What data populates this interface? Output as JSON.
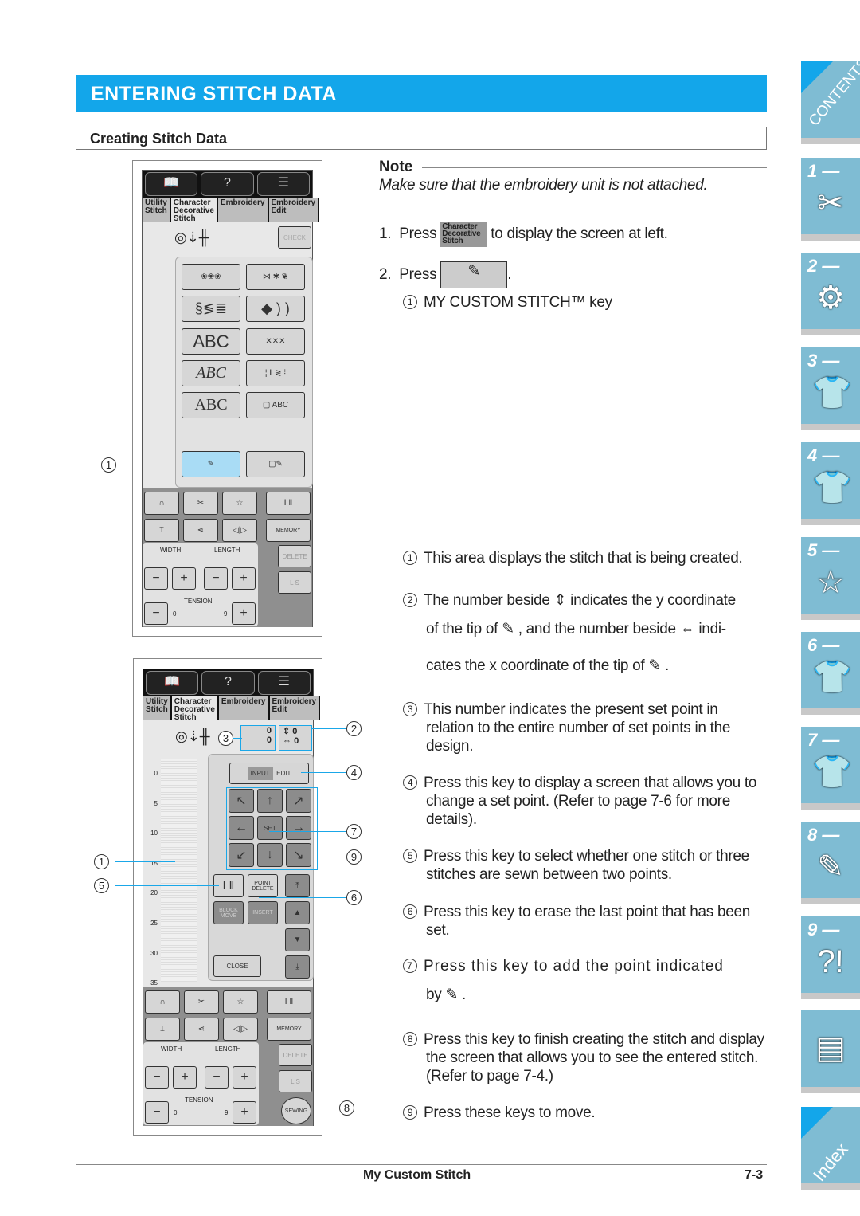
{
  "header": {
    "title": "ENTERING STITCH DATA",
    "subtitle": "Creating Stitch Data"
  },
  "screen": {
    "top_icons": [
      "sewing-guide-icon",
      "help-machine-icon",
      "checklist-icon"
    ],
    "tabs": [
      "Utility Stitch",
      "Character Decorative Stitch",
      "Embroidery",
      "Embroidery Edit"
    ],
    "check": "CHECK",
    "stitch_buttons": [
      "decorative-1",
      "decorative-2",
      "satin-1",
      "satin-2",
      "ABC",
      "cross-stitch",
      "𝒜ℬ𝒞",
      "utility-patterns",
      "ABC",
      "ABC-pocket"
    ],
    "abc_label": "ABC",
    "controls": {
      "memory": "MEMORY",
      "width": "WIDTH",
      "length": "LENGTH",
      "delete": "DELETE",
      "ls": "L  S",
      "tension": "TENSION",
      "t_min": "0",
      "t_max": "9",
      "sewing": "SEWING"
    },
    "editor": {
      "input": "INPUT",
      "edit": "EDIT",
      "set": "SET",
      "point_delete": "POINT DELETE",
      "block_move": "BLOCK MOVE",
      "insert": "INSERT",
      "close": "CLOSE",
      "point_num": "0",
      "point_den": "0",
      "y": "0",
      "x": "0",
      "ruler": [
        "0",
        "5",
        "10",
        "15",
        "20",
        "25",
        "30",
        "35"
      ]
    }
  },
  "callouts": [
    "1",
    "2",
    "3",
    "4",
    "5",
    "6",
    "7",
    "8",
    "9"
  ],
  "note": {
    "title": "Note",
    "text": "Make sure that the embroidery unit is not attached."
  },
  "steps": [
    {
      "n": "1.",
      "pre": "Press",
      "key": "Character Decorative Stitch",
      "post": "to display the screen at left."
    },
    {
      "n": "2.",
      "pre": "Press",
      "post": "."
    }
  ],
  "key_desc": "MY CUSTOM STITCH™ key",
  "items": [
    "This area displays the stitch that is being created.",
    "The number beside ⇕ indicates the y coordinate",
    "of the tip of",
    ", and the number beside ⇔ indi-",
    "cates the x coordinate of the tip of",
    ".",
    "This number indicates the present set point in relation to the entire number of set points in the design.",
    "Press this key to display a screen that allows you to change a set point. (Refer to page 7-6 for more details).",
    "Press this key to select whether one stitch or three stitches are sewn between two points.",
    "Press this key to erase the last point that has been set.",
    "Press this key to add the point indicated",
    "by",
    "Press this key to finish creating the stitch and display the screen that allows you to see the entered stitch. (Refer to page 7-4.)",
    "Press these keys to move."
  ],
  "footer": {
    "title": "My Custom Stitch",
    "page": "7-3"
  },
  "side_tabs": [
    {
      "label": "CONTENTS"
    },
    {
      "label": "1 —",
      "icon": "✂"
    },
    {
      "label": "2 —",
      "icon": "⚙"
    },
    {
      "label": "3 —",
      "icon": "👕"
    },
    {
      "label": "4 —",
      "icon": "👕"
    },
    {
      "label": "5 —",
      "icon": "☆"
    },
    {
      "label": "6 —",
      "icon": "👕"
    },
    {
      "label": "7 —",
      "icon": "👕"
    },
    {
      "label": "8 —",
      "icon": "✎"
    },
    {
      "label": "9 —",
      "icon": "?!"
    },
    {
      "label": "",
      "icon": "▤"
    },
    {
      "label": "Index"
    }
  ],
  "colors": {
    "accent": "#13a6ea",
    "tab": "#7fbcd3"
  }
}
